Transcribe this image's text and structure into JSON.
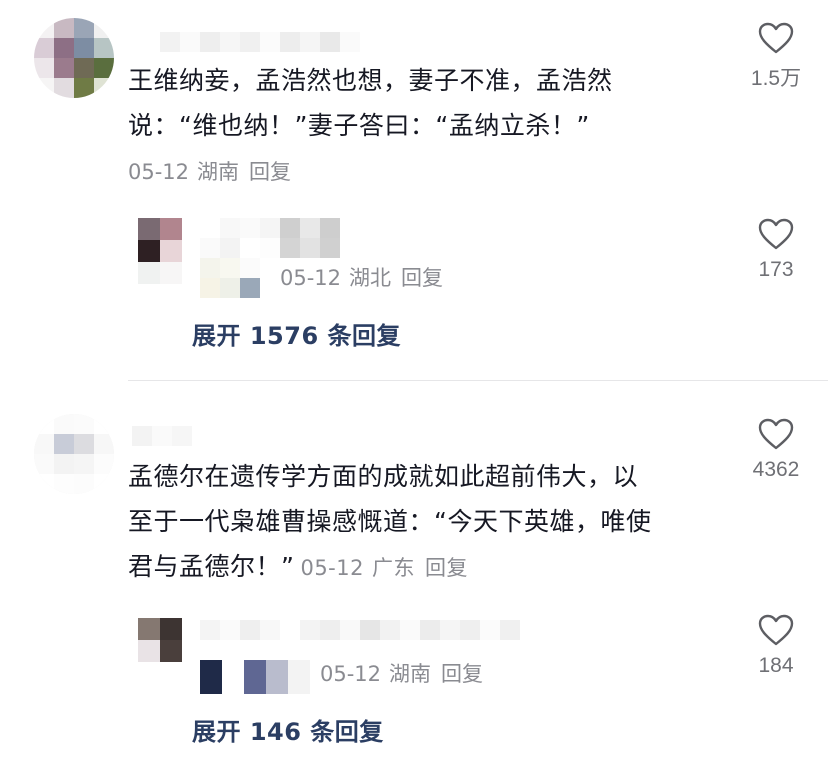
{
  "colors": {
    "text": "#161823",
    "meta": "#8a8b91",
    "expand": "#2b3e63",
    "divider": "#e6e6e8"
  },
  "comments": [
    {
      "text_lines": [
        "王维纳妾，孟浩然也想，妻子不准，孟浩然",
        "说：“维也纳！”妻子答曰：“孟纳立杀！”"
      ],
      "date": "05-12",
      "location": "湖南",
      "reply_label": "回复",
      "likes": "1.5万",
      "like_icon": "heart-outline-icon",
      "reply": {
        "date": "05-12",
        "location": "湖北",
        "reply_label": "回复",
        "likes": "173",
        "like_icon": "heart-outline-icon"
      },
      "expand_label": "展开 1576 条回复"
    },
    {
      "text_lines": [
        "孟德尔在遗传学方面的成就如此超前伟大，以",
        "至于一代枭雄曹操感慨道：“今天下英雄，唯使",
        "君与孟德尔！”"
      ],
      "date": "05-12",
      "location": "广东",
      "reply_label": "回复",
      "likes": "4362",
      "like_icon": "heart-outline-icon",
      "reply": {
        "date": "05-12",
        "location": "湖南",
        "reply_label": "回复",
        "likes": "184",
        "like_icon": "heart-outline-icon"
      },
      "expand_label": "展开 146 条回复"
    }
  ]
}
